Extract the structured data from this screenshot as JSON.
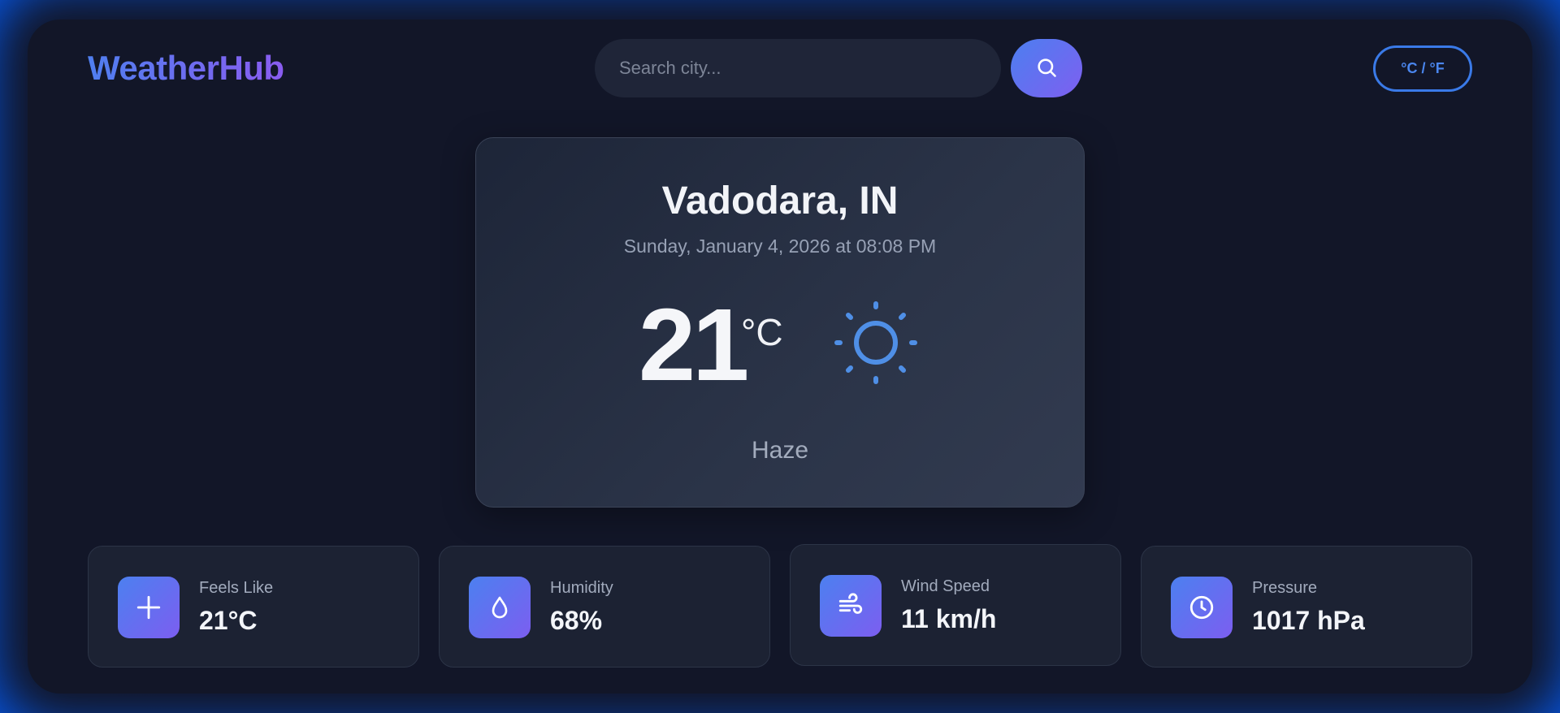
{
  "header": {
    "logo": "WeatherHub",
    "search_placeholder": "Search city...",
    "search_value": "",
    "search_button_icon": "search-icon",
    "unit_toggle_label": "°C / °F"
  },
  "current": {
    "city": "Vadodara, IN",
    "datetime": "Sunday, January 4, 2026 at 08:08 PM",
    "temperature": "21",
    "unit": "°C",
    "condition_icon": "sun-icon",
    "condition": "Haze"
  },
  "stats": [
    {
      "label": "Feels Like",
      "value": "21°C",
      "icon": "plus-icon"
    },
    {
      "label": "Humidity",
      "value": "68%",
      "icon": "droplet-icon"
    },
    {
      "label": "Wind Speed",
      "value": "11 km/h",
      "icon": "wind-icon"
    },
    {
      "label": "Pressure",
      "value": "1017 hPa",
      "icon": "clock-icon"
    }
  ],
  "colors": {
    "accent": "#4c7ff0",
    "accent_secondary": "#7e5ff0",
    "background": "#121628",
    "frame": "#0650d4"
  }
}
